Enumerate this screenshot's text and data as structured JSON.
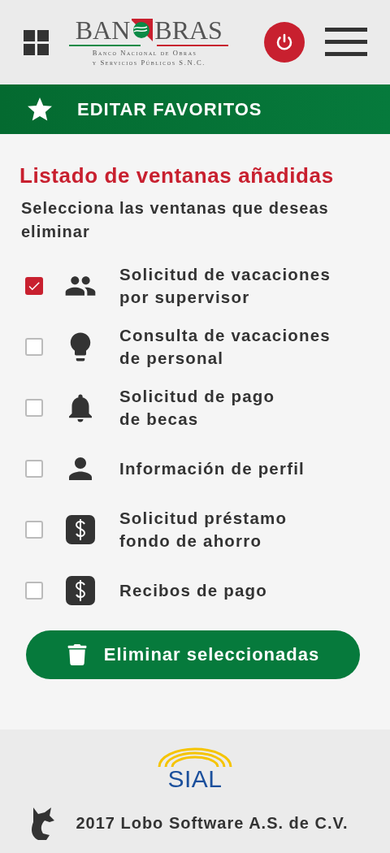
{
  "header": {
    "logo_left": "BAN",
    "logo_right": "BRAS",
    "logo_subtitle": "Banco Nacional de Obras\ny Servicios Públicos S.N.C."
  },
  "section_bar": {
    "title": "EDITAR FAVORITOS"
  },
  "content": {
    "heading": "Listado de ventanas añadidas",
    "instructions": "Selecciona las ventanas que deseas eliminar",
    "items": [
      {
        "label": "Solicitud de vacaciones\npor supervisor",
        "kind": "people",
        "checked": true
      },
      {
        "label": "Consulta de vacaciones\nde personal",
        "kind": "bulb",
        "checked": false
      },
      {
        "label": "Solicitud de pago\nde becas",
        "kind": "bell",
        "checked": false
      },
      {
        "label": "Información de perfil",
        "kind": "person",
        "checked": false
      },
      {
        "label": "Solicitud préstamo\nfondo de ahorro",
        "kind": "dollar",
        "checked": false
      },
      {
        "label": "Recibos de pago",
        "kind": "dollar",
        "checked": false
      }
    ],
    "delete_button": "Eliminar seleccionadas"
  },
  "footer": {
    "logo": "SIAL",
    "copyright": "2017 Lobo Software A.S. de C.V."
  }
}
